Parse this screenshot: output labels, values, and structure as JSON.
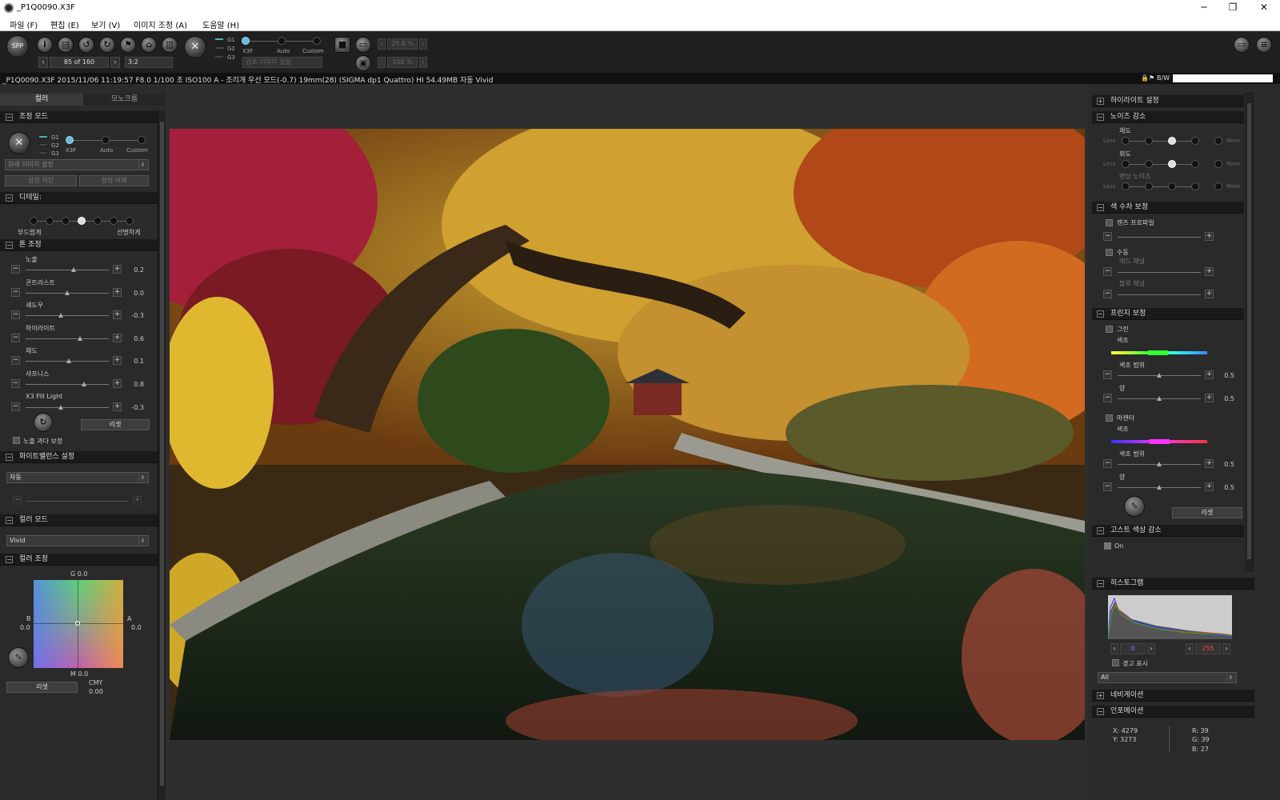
{
  "window": {
    "title": "_P1Q0090.X3F",
    "minimize": "─",
    "maximize": "❐",
    "close": "✕"
  },
  "menu": [
    "파일 (F)",
    "편집 (E)",
    "보기 (V)",
    "이미지 조정 (A)",
    "도움말 (H)"
  ],
  "toolbar": {
    "frame_counter": "85 of 160",
    "aspect": "3:2",
    "g_labels": [
      "G1",
      "G2",
      "G3"
    ],
    "mode_labels": [
      "X3F",
      "Auto",
      "Custom"
    ],
    "preset_select": "감조 이미지 설정",
    "zoom_value": "25.8 %",
    "zoom_value2": "100 %",
    "app_icon": "SPP"
  },
  "info": {
    "text": "_P1Q0090.X3F 2015/11/06 11:19:57 F8.0 1/100 초 ISO100 A - 조리개 우선 모드(-0.7) 19mm(28) (SIGMA dp1 Quattro) HI 54.49MB 자동 Vivid",
    "bw_label": "B/W"
  },
  "left": {
    "tabs": [
      "컬러",
      "모노크롬"
    ],
    "adjust_mode": {
      "title": "조정 모드",
      "g_labels": [
        "G1",
        "G2",
        "G3"
      ],
      "mode_labels": [
        "X3F",
        "Auto",
        "Custom"
      ],
      "preset": "원래 이미지 설정",
      "save_btn": "설정 저장",
      "delete_btn": "설정 삭제"
    },
    "detail": {
      "title": "디테일:",
      "soft": "부드럽게",
      "sharp": "선명하게"
    },
    "tone": {
      "title": "톤 조정",
      "sliders": [
        {
          "label": "노출",
          "value": "0.2",
          "pos": 0.58
        },
        {
          "label": "콘트라스트",
          "value": "0.0",
          "pos": 0.5
        },
        {
          "label": "섀도우",
          "value": "-0.3",
          "pos": 0.42
        },
        {
          "label": "하이라이트",
          "value": "0.6",
          "pos": 0.65
        },
        {
          "label": "채도",
          "value": "0.1",
          "pos": 0.52
        },
        {
          "label": "샤프니스",
          "value": "0.8",
          "pos": 0.7
        },
        {
          "label": "X3 Fill Light",
          "value": "-0.3",
          "pos": 0.42
        }
      ],
      "reset": "리셋",
      "overexposure": "노출 과다 보정"
    },
    "wb": {
      "title": "화이트밸런스 설정",
      "value": "자동"
    },
    "color_mode": {
      "title": "컬러 모드",
      "value": "Vivid"
    },
    "color_adjust": {
      "title": "컬러 조정",
      "g": "G 0.0",
      "b": "B",
      "b_val": "0.0",
      "a": "A",
      "a_val": "0.0",
      "m": "M 0.0",
      "cmy": "CMY",
      "cmy_val": "0.00",
      "reset": "리셋"
    }
  },
  "right": {
    "highlight": "하이라이트 설정",
    "noise": {
      "title": "노이즈 감소",
      "rows": [
        {
          "label": "채도",
          "pos": 2
        },
        {
          "label": "휘도",
          "pos": 2
        },
        {
          "label": "밴딩 노이즈",
          "pos": 0
        }
      ],
      "less": "Less",
      "more": "More"
    },
    "aberration": {
      "title": "색 수차 보정",
      "lens_profile": "렌즈 프로파일",
      "manual": "수동",
      "red": "레드 채널",
      "blue": "블루 채널"
    },
    "fringe": {
      "title": "프린지 보정",
      "green": "그린",
      "magenta": "마젠타",
      "hue": "색조",
      "range": "색조 범위",
      "amount": "양",
      "values": [
        "0.5",
        "0.5",
        "0.5",
        "0.5"
      ],
      "reset": "리셋"
    },
    "ghost": {
      "title": "고스트 색상 감소",
      "on": "On"
    },
    "histogram": {
      "title": "히스토그램",
      "low": "0",
      "high": "255",
      "warn": "경고 표시",
      "channel": "All"
    },
    "navigation": "네비게이션",
    "information": {
      "title": "인포메이션",
      "x": "X: 4279",
      "y": "Y: 3273",
      "r": "R:  39",
      "g": "G:  39",
      "b": "B:  27"
    }
  },
  "colors": {
    "accent": "#66bbdd",
    "bg": "#2a2a2a",
    "panel_header": "#1a1a1a"
  }
}
